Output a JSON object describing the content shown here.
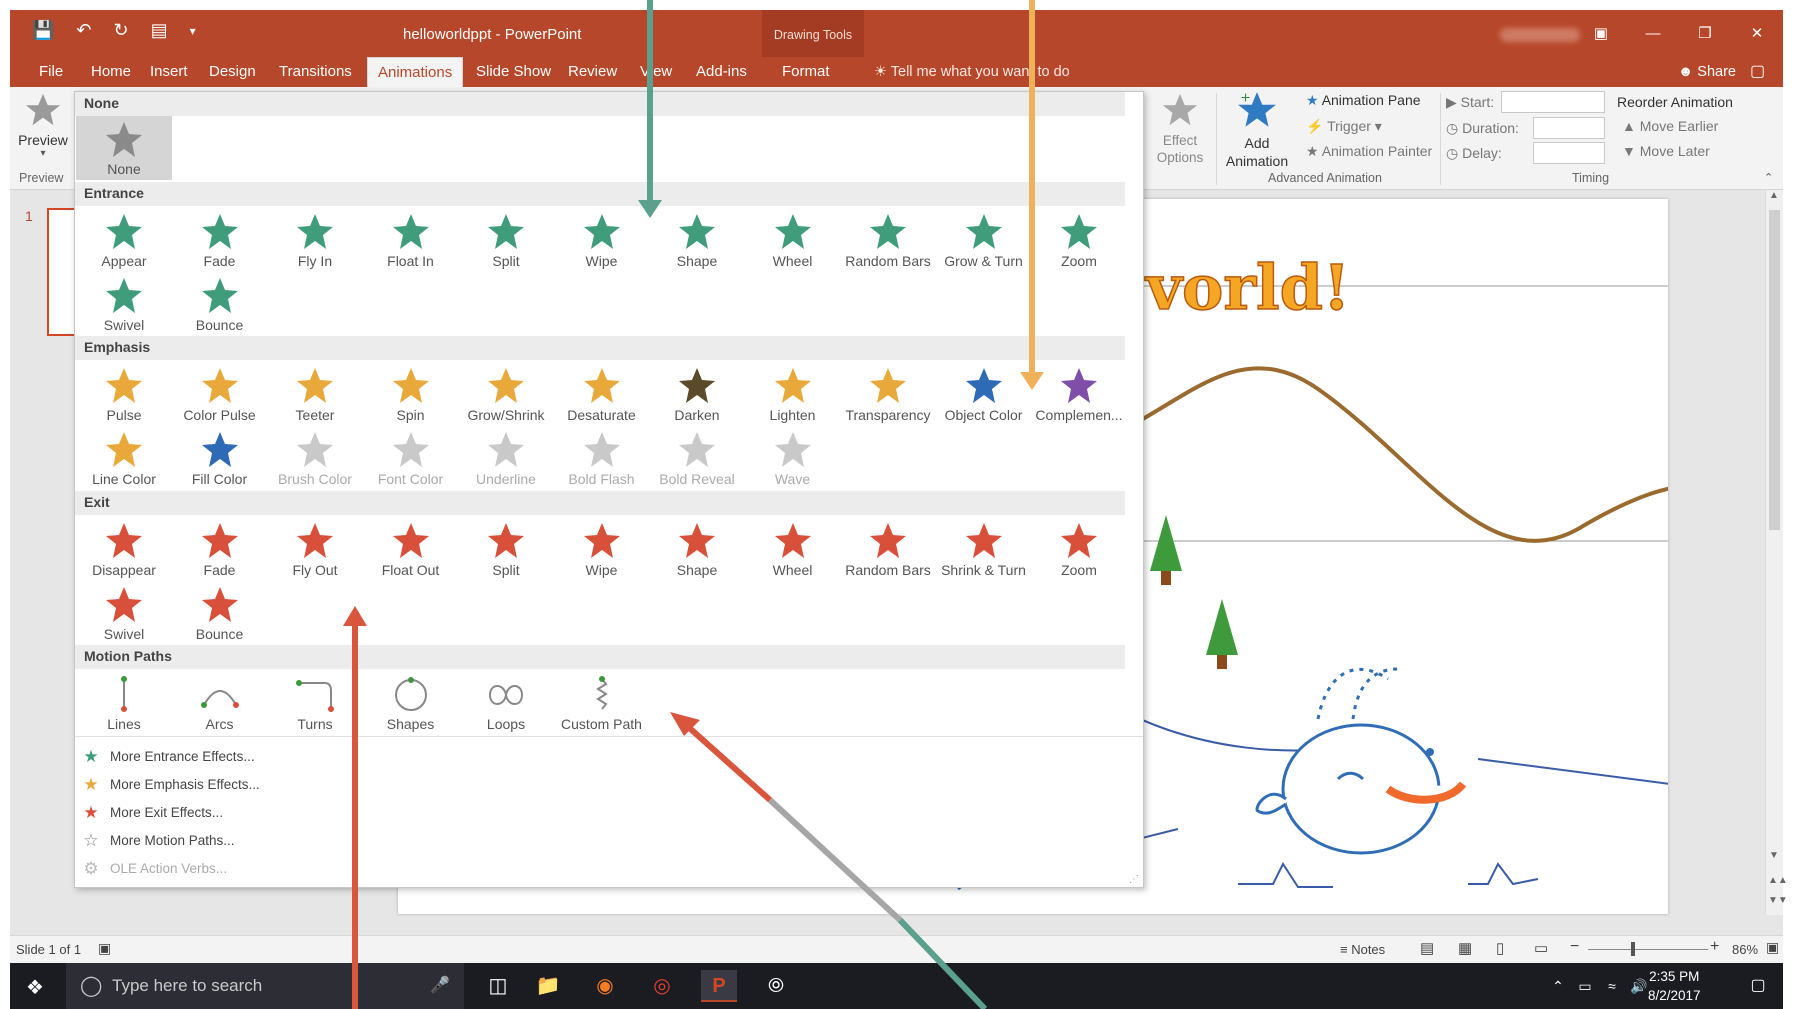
{
  "titlebar": {
    "document_title": "helloworldppt - PowerPoint",
    "context_group": "Drawing Tools"
  },
  "tabs": [
    {
      "label": "File"
    },
    {
      "label": "Home"
    },
    {
      "label": "Insert"
    },
    {
      "label": "Design"
    },
    {
      "label": "Transitions"
    },
    {
      "label": "Animations"
    },
    {
      "label": "Slide Show"
    },
    {
      "label": "Review"
    },
    {
      "label": "View"
    },
    {
      "label": "Add-ins"
    },
    {
      "label": "Format"
    }
  ],
  "active_tab": "Animations",
  "tell_me": "Tell me what you want to do",
  "share_label": "Share",
  "ribbon": {
    "preview_label": "Preview",
    "preview_group": "Preview",
    "effect_options": "Effect Options",
    "add_animation": "Add Animation",
    "animation_pane": "Animation Pane",
    "trigger": "Trigger",
    "animation_painter": "Animation Painter",
    "advanced_group": "Advanced Animation",
    "start_label": "Start:",
    "duration_label": "Duration:",
    "delay_label": "Delay:",
    "timing_group": "Timing",
    "reorder_label": "Reorder Animation",
    "move_earlier": "Move Earlier",
    "move_later": "Move Later"
  },
  "slide": {
    "title_fragment": "vorld!",
    "slide_number": "1"
  },
  "gallery": {
    "sections": [
      {
        "title": "None",
        "color": "#8a8a8a",
        "items": [
          {
            "label": "None",
            "selected": true
          }
        ]
      },
      {
        "title": "Entrance",
        "color": "#3f9d7c",
        "items": [
          {
            "label": "Appear"
          },
          {
            "label": "Fade"
          },
          {
            "label": "Fly In"
          },
          {
            "label": "Float In"
          },
          {
            "label": "Split"
          },
          {
            "label": "Wipe"
          },
          {
            "label": "Shape"
          },
          {
            "label": "Wheel"
          },
          {
            "label": "Random Bars"
          },
          {
            "label": "Grow & Turn"
          },
          {
            "label": "Zoom"
          },
          {
            "label": "Swivel"
          },
          {
            "label": "Bounce"
          }
        ]
      },
      {
        "title": "Emphasis",
        "color": "#e8a83a",
        "items": [
          {
            "label": "Pulse"
          },
          {
            "label": "Color Pulse"
          },
          {
            "label": "Teeter"
          },
          {
            "label": "Spin"
          },
          {
            "label": "Grow/Shrink"
          },
          {
            "label": "Desaturate"
          },
          {
            "label": "Darken"
          },
          {
            "label": "Lighten"
          },
          {
            "label": "Transparency"
          },
          {
            "label": "Object Color"
          },
          {
            "label": "Complemen..."
          },
          {
            "label": "Line Color"
          },
          {
            "label": "Fill Color"
          },
          {
            "label": "Brush Color",
            "disabled": true
          },
          {
            "label": "Font Color",
            "disabled": true
          },
          {
            "label": "Underline",
            "disabled": true
          },
          {
            "label": "Bold Flash",
            "disabled": true
          },
          {
            "label": "Bold Reveal",
            "disabled": true
          },
          {
            "label": "Wave",
            "disabled": true
          }
        ]
      },
      {
        "title": "Exit",
        "color": "#d8503a",
        "items": [
          {
            "label": "Disappear"
          },
          {
            "label": "Fade"
          },
          {
            "label": "Fly Out"
          },
          {
            "label": "Float Out"
          },
          {
            "label": "Split"
          },
          {
            "label": "Wipe"
          },
          {
            "label": "Shape"
          },
          {
            "label": "Wheel"
          },
          {
            "label": "Random Bars"
          },
          {
            "label": "Shrink & Turn"
          },
          {
            "label": "Zoom"
          },
          {
            "label": "Swivel"
          },
          {
            "label": "Bounce"
          }
        ]
      },
      {
        "title": "Motion Paths",
        "color": "#777777",
        "items": [
          {
            "label": "Lines"
          },
          {
            "label": "Arcs"
          },
          {
            "label": "Turns"
          },
          {
            "label": "Shapes"
          },
          {
            "label": "Loops"
          },
          {
            "label": "Custom Path"
          }
        ]
      }
    ],
    "more": [
      {
        "label": "More Entrance Effects...",
        "icon_color": "#3f9d7c"
      },
      {
        "label": "More Emphasis Effects...",
        "icon_color": "#e8a83a"
      },
      {
        "label": "More Exit Effects...",
        "icon_color": "#d8503a"
      },
      {
        "label": "More Motion Paths...",
        "icon_color": "#888888"
      },
      {
        "label": "OLE Action Verbs...",
        "icon_color": "#bbbbbb",
        "disabled": true
      }
    ]
  },
  "status": {
    "slide_info": "Slide 1 of 1",
    "notes": "Notes",
    "zoom": "86%"
  },
  "taskbar": {
    "search_placeholder": "Type here to search",
    "time": "2:35 PM",
    "date": "8/2/2017"
  },
  "colors": {
    "accent": "#b7472a",
    "entrance": "#3f9d7c",
    "emphasis": "#e8a83a",
    "exit": "#d8503a"
  }
}
